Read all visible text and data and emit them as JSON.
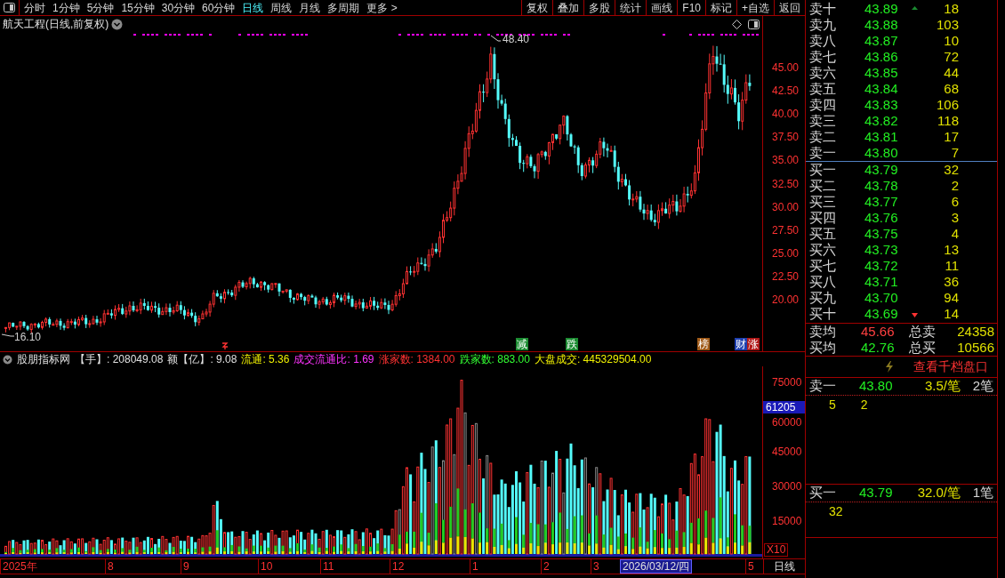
{
  "toolbar": {
    "periods": [
      {
        "label": "分时",
        "selected": false
      },
      {
        "label": "1分钟",
        "selected": false
      },
      {
        "label": "5分钟",
        "selected": false
      },
      {
        "label": "15分钟",
        "selected": false
      },
      {
        "label": "30分钟",
        "selected": false
      },
      {
        "label": "60分钟",
        "selected": false
      },
      {
        "label": "日线",
        "selected": true
      },
      {
        "label": "周线",
        "selected": false
      },
      {
        "label": "月线",
        "selected": false
      },
      {
        "label": "多周期",
        "selected": false
      },
      {
        "label": "更多 >",
        "selected": false
      }
    ],
    "actions": [
      "复权",
      "叠加",
      "多股",
      "统计",
      "画线",
      "F10",
      "标记",
      "+自选",
      "返回"
    ]
  },
  "chart": {
    "title": "航天工程(日线,前复权)",
    "high_label": "48.40",
    "low_label": "16.10",
    "price_ticks": [
      "45.00",
      "42.50",
      "40.00",
      "37.50",
      "35.00",
      "32.50",
      "30.00",
      "27.50",
      "25.00",
      "22.50",
      "20.00"
    ],
    "markers": [
      {
        "label": "减",
        "color": "#1a8a30"
      },
      {
        "label": "跌",
        "color": "#1a8a30"
      },
      {
        "label": "榜",
        "color": "#a05a18"
      },
      {
        "label": "财",
        "color": "#1e3fb0"
      },
      {
        "label": "涨",
        "color": "#b01818"
      }
    ]
  },
  "indicator": {
    "name": "股朋指标网",
    "fields": [
      {
        "text": "【手】: 208049.08",
        "color": "#e0e0e0"
      },
      {
        "text": "额【亿】: 9.08",
        "color": "#e0e0e0"
      },
      {
        "text": "流通: 5.36",
        "color": "#f0f000"
      },
      {
        "text": "成交流通比: 1.69",
        "color": "#ff33ff"
      },
      {
        "text": "涨家数: 1384.00",
        "color": "#ff3232"
      },
      {
        "text": "跌家数: 883.00",
        "color": "#33ff33"
      },
      {
        "text": "大盘成交: 445329504.00",
        "color": "#f0f000"
      }
    ]
  },
  "volume": {
    "ticks": [
      "75000",
      "60000",
      "45000",
      "30000",
      "15000"
    ],
    "current": "61205",
    "scale": "X10"
  },
  "date_axis": {
    "labels": [
      "2025年",
      "8",
      "9",
      "10",
      "11",
      "12",
      "1",
      "2",
      "3",
      "5"
    ],
    "cursor_date": "2026/03/12/四",
    "period": "日线"
  },
  "order_book": {
    "asks": [
      {
        "label": "卖十",
        "price": "43.89",
        "volume": "18"
      },
      {
        "label": "卖九",
        "price": "43.88",
        "volume": "103"
      },
      {
        "label": "卖八",
        "price": "43.87",
        "volume": "10"
      },
      {
        "label": "卖七",
        "price": "43.86",
        "volume": "72"
      },
      {
        "label": "卖六",
        "price": "43.85",
        "volume": "44"
      },
      {
        "label": "卖五",
        "price": "43.84",
        "volume": "68"
      },
      {
        "label": "卖四",
        "price": "43.83",
        "volume": "106"
      },
      {
        "label": "卖三",
        "price": "43.82",
        "volume": "118"
      },
      {
        "label": "卖二",
        "price": "43.81",
        "volume": "17"
      },
      {
        "label": "卖一",
        "price": "43.80",
        "volume": "7"
      }
    ],
    "bids": [
      {
        "label": "买一",
        "price": "43.79",
        "volume": "32"
      },
      {
        "label": "买二",
        "price": "43.78",
        "volume": "2"
      },
      {
        "label": "买三",
        "price": "43.77",
        "volume": "6"
      },
      {
        "label": "买四",
        "price": "43.76",
        "volume": "3"
      },
      {
        "label": "买五",
        "price": "43.75",
        "volume": "4"
      },
      {
        "label": "买六",
        "price": "43.73",
        "volume": "13"
      },
      {
        "label": "买七",
        "price": "43.72",
        "volume": "11"
      },
      {
        "label": "买八",
        "price": "43.71",
        "volume": "36"
      },
      {
        "label": "买九",
        "price": "43.70",
        "volume": "94"
      },
      {
        "label": "买十",
        "price": "43.69",
        "volume": "14"
      }
    ],
    "summary": [
      {
        "kind": "sell",
        "label": "卖均",
        "price": "45.66",
        "total_label": "总卖",
        "total": "24358"
      },
      {
        "kind": "buy",
        "label": "买均",
        "price": "42.76",
        "total_label": "总买",
        "total": "10566"
      }
    ]
  },
  "queue": {
    "button": "查看千档盘口",
    "levels": [
      {
        "label": "卖一",
        "price": "43.80",
        "avg": "3.5/笔",
        "count": "2笔",
        "orders": [
          "5",
          "2"
        ]
      },
      {
        "label": "买一",
        "price": "43.79",
        "avg": "32.0/笔",
        "count": "1笔",
        "orders": [
          "32"
        ]
      }
    ]
  }
}
